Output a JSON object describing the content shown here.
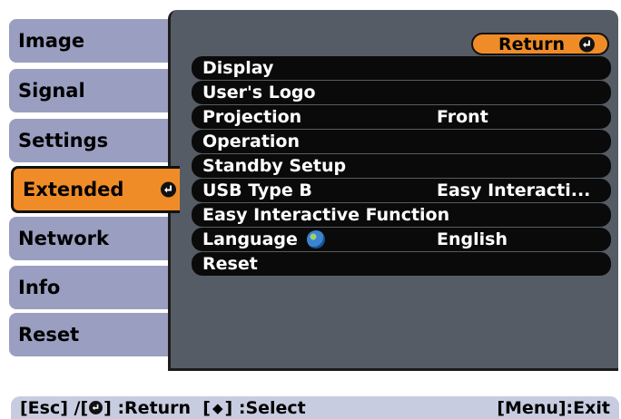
{
  "tabs": [
    {
      "label": "Image"
    },
    {
      "label": "Signal"
    },
    {
      "label": "Settings"
    },
    {
      "label": "Extended",
      "active": true
    },
    {
      "label": "Network"
    },
    {
      "label": "Info"
    },
    {
      "label": "Reset"
    }
  ],
  "return_button": {
    "label": "Return"
  },
  "menu": [
    {
      "label": "Display",
      "value": ""
    },
    {
      "label": "User's Logo",
      "value": ""
    },
    {
      "label": "Projection",
      "value": "Front"
    },
    {
      "label": "Operation",
      "value": ""
    },
    {
      "label": "Standby Setup",
      "value": ""
    },
    {
      "label": "USB Type B",
      "value": "Easy Interacti..."
    },
    {
      "label": "Easy Interactive Function",
      "value": ""
    },
    {
      "label": "Language",
      "value": "English",
      "icon": "globe-icon"
    },
    {
      "label": "Reset",
      "value": ""
    }
  ],
  "footer": {
    "esc_text": "[Esc] /[",
    "return_text": "] :Return  [",
    "select_text": "] :Select",
    "exit_text": "[Menu]:Exit"
  },
  "colors": {
    "tab_bg": "#9a9ec0",
    "accent": "#f08c28",
    "panel_bg": "#565c65",
    "row_bg": "#0a0a0a",
    "footer_bg": "#c8cce0"
  }
}
